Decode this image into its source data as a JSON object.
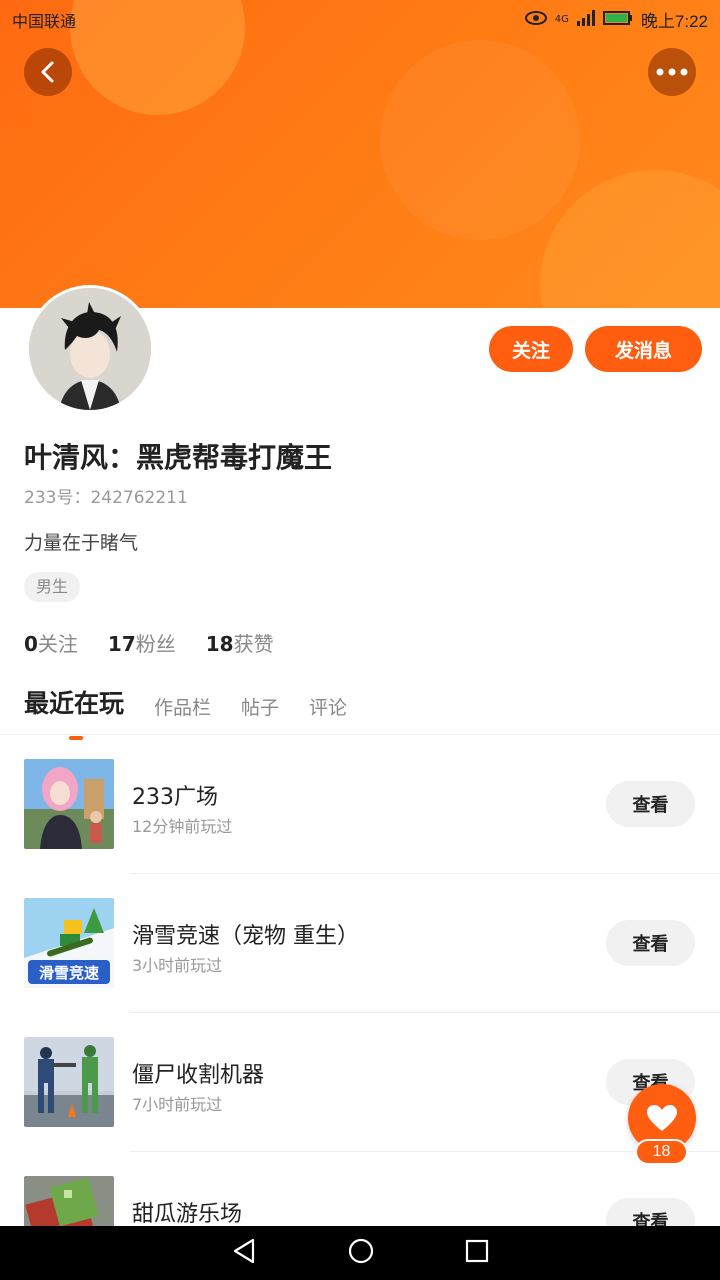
{
  "status_bar": {
    "carrier": "中国联通",
    "time": "晚上7:22",
    "network": "4G"
  },
  "header": {
    "back_icon": "chevron-left-icon",
    "more_icon": "more-dots-icon"
  },
  "profile": {
    "follow_label": "关注",
    "message_label": "发消息",
    "name": "叶清风：黑虎帮毒打魔王",
    "uid": "233号：242762211",
    "bio": "力量在于睹气",
    "gender": "男生",
    "stats": [
      {
        "value": "0",
        "label": "关注"
      },
      {
        "value": "17",
        "label": "粉丝"
      },
      {
        "value": "18",
        "label": "获赞"
      }
    ]
  },
  "tabs": [
    {
      "label": "最近在玩",
      "active": true
    },
    {
      "label": "作品栏",
      "active": false
    },
    {
      "label": "帖子",
      "active": false
    },
    {
      "label": "评论",
      "active": false
    }
  ],
  "games": [
    {
      "title": "233广场",
      "time": "12分钟前玩过",
      "button": "查看"
    },
    {
      "title": "滑雪竞速（宠物 重生）",
      "time": "3小时前玩过",
      "button": "查看"
    },
    {
      "title": "僵尸收割机器",
      "time": "7小时前玩过",
      "button": "查看"
    },
    {
      "title": "甜瓜游乐场",
      "time": "",
      "button": "查看"
    }
  ],
  "like_fab": {
    "count": "18"
  },
  "colors": {
    "accent": "#ff5d10",
    "banner": "#ff7a14"
  }
}
